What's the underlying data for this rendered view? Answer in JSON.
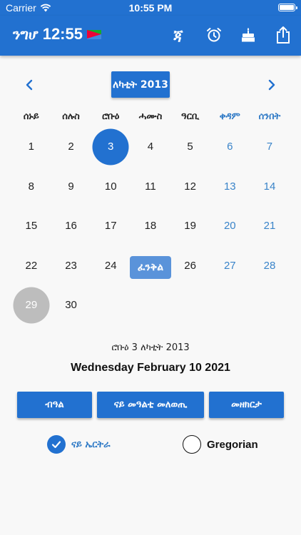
{
  "status_bar": {
    "carrier": "Carrier",
    "time": "10:55 PM"
  },
  "app_bar": {
    "title": "ንግሆ",
    "clock": "12:55",
    "actions": [
      {
        "icon": "ethiopic-letter-icon",
        "label": "ጃ"
      },
      {
        "icon": "alarm-clock-icon"
      },
      {
        "icon": "birthday-cake-icon"
      },
      {
        "icon": "share-icon"
      }
    ]
  },
  "calendar": {
    "prev_icon": "chevron-left-icon",
    "next_icon": "chevron-right-icon",
    "month_label": "ለካቲት 2013",
    "weekdays": [
      "ሰኑይ",
      "ሰሉስ",
      "ሮቡዕ",
      "ሓሙስ",
      "ዓርቢ",
      "ቀዳም",
      "ሰንበት"
    ],
    "weekend_color": "#2f7ac6",
    "rows": [
      [
        "1",
        "2",
        "3",
        "4",
        "5",
        "6",
        "7"
      ],
      [
        "8",
        "9",
        "10",
        "11",
        "12",
        "13",
        "14"
      ],
      [
        "15",
        "16",
        "17",
        "18",
        "19",
        "20",
        "21"
      ],
      [
        "22",
        "23",
        "24",
        "",
        "26",
        "27",
        "28"
      ],
      [
        "29",
        "30",
        "",
        "",
        "",
        "",
        ""
      ]
    ],
    "selected_day": "3",
    "today_day": "29",
    "holiday_tooltip": "ፈንቅል"
  },
  "selected": {
    "ethiopian_date": "ሮቡዕ 3 ለካቲት 2013",
    "gregorian_date": "Wednesday February 10 2021"
  },
  "buttons": {
    "holiday": "ብዓል",
    "convert": "ናይ መዓልቲ መለወጢ",
    "reminder": "መዘክርታ"
  },
  "calendar_mode": {
    "eritrean_label": "ናይ ኤርትራ",
    "gregorian_label": "Gregorian",
    "selected": "eritrean"
  },
  "colors": {
    "primary": "#2271d0",
    "today_gray": "#bdbdbd",
    "tooltip": "#5a93da"
  }
}
